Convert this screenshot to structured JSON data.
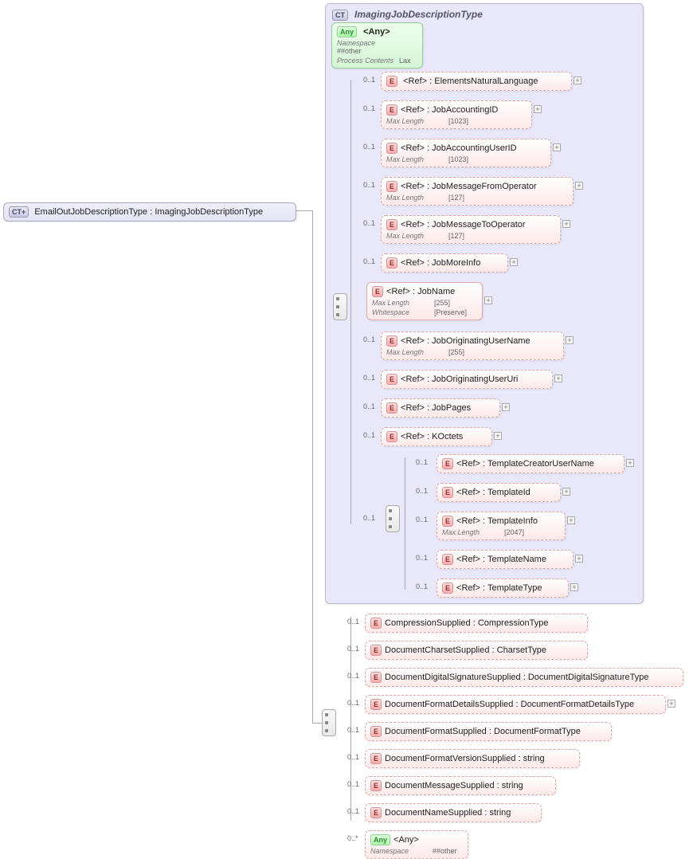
{
  "badges": {
    "ct": "CT",
    "ctplus": "CT+",
    "e": "E",
    "any": "Any"
  },
  "root": {
    "name": "EmailOutJobDescriptionType",
    "base": "ImagingJobDescriptionType"
  },
  "group": {
    "title": "ImagingJobDescriptionType",
    "any": {
      "label": "<Any>",
      "ns_k": "Namespace",
      "ns_v": "##other",
      "pc_k": "Process Contents",
      "pc_v": "Lax"
    },
    "refs": [
      {
        "label": "<Ref>",
        "type": "ElementsNaturalLanguage",
        "occ": "0..1"
      },
      {
        "label": "<Ref>",
        "type": "JobAccountingID",
        "occ": "0..1",
        "meta": [
          [
            "Max Length",
            "[1023]"
          ]
        ]
      },
      {
        "label": "<Ref>",
        "type": "JobAccountingUserID",
        "occ": "0..1",
        "meta": [
          [
            "Max Length",
            "[1023]"
          ]
        ]
      },
      {
        "label": "<Ref>",
        "type": "JobMessageFromOperator",
        "occ": "0..1",
        "meta": [
          [
            "Max Length",
            "[127]"
          ]
        ]
      },
      {
        "label": "<Ref>",
        "type": "JobMessageToOperator",
        "occ": "0..1",
        "meta": [
          [
            "Max Length",
            "[127]"
          ]
        ]
      },
      {
        "label": "<Ref>",
        "type": "JobMoreInfo",
        "occ": "0..1"
      },
      {
        "label": "<Ref>",
        "type": "JobName",
        "meta": [
          [
            "Max Length",
            "[255]"
          ],
          [
            "Whitespace",
            "[Preserve]"
          ]
        ],
        "solid": true
      },
      {
        "label": "<Ref>",
        "type": "JobOriginatingUserName",
        "occ": "0..1",
        "meta": [
          [
            "Max Length",
            "[255]"
          ]
        ]
      },
      {
        "label": "<Ref>",
        "type": "JobOriginatingUserUri",
        "occ": "0..1"
      },
      {
        "label": "<Ref>",
        "type": "JobPages",
        "occ": "0..1"
      },
      {
        "label": "<Ref>",
        "type": "KOctets",
        "occ": "0..1"
      }
    ],
    "template": {
      "occ": "0..1",
      "refs": [
        {
          "label": "<Ref>",
          "type": "TemplateCreatorUserName",
          "occ": "0..1"
        },
        {
          "label": "<Ref>",
          "type": "TemplateId",
          "occ": "0..1"
        },
        {
          "label": "<Ref>",
          "type": "TemplateInfo",
          "occ": "0..1",
          "meta": [
            [
              "Max Length",
              "[2047]"
            ]
          ]
        },
        {
          "label": "<Ref>",
          "type": "TemplateName",
          "occ": "0..1"
        },
        {
          "label": "<Ref>",
          "type": "TemplateType",
          "occ": "0..1"
        }
      ]
    }
  },
  "ext": {
    "elems": [
      {
        "name": "CompressionSupplied",
        "type": "CompressionType",
        "occ": "0..1"
      },
      {
        "name": "DocumentCharsetSupplied",
        "type": "CharsetType",
        "occ": "0..1"
      },
      {
        "name": "DocumentDigitalSignatureSupplied",
        "type": "DocumentDigitalSignatureType",
        "occ": "0..1"
      },
      {
        "name": "DocumentFormatDetailsSupplied",
        "type": "DocumentFormatDetailsType",
        "occ": "0..1"
      },
      {
        "name": "DocumentFormatSupplied",
        "type": "DocumentFormatType",
        "occ": "0..1"
      },
      {
        "name": "DocumentFormatVersionSupplied",
        "type": "string",
        "occ": "0..1"
      },
      {
        "name": "DocumentMessageSupplied",
        "type": "string",
        "occ": "0..1"
      },
      {
        "name": "DocumentNameSupplied",
        "type": "string",
        "occ": "0..1"
      }
    ],
    "any": {
      "label": "<Any>",
      "occ": "0..*",
      "ns_k": "Namespace",
      "ns_v": "##other"
    }
  }
}
